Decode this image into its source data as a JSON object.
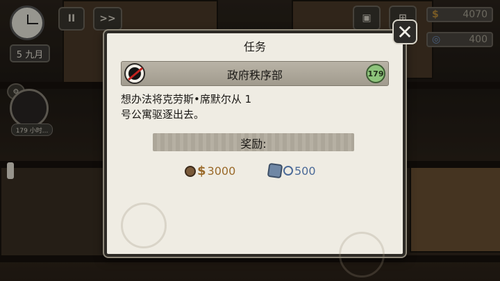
{
  "hud": {
    "date_label": "5 九月",
    "pause_label": "II",
    "fastforward_label": ">>",
    "money": {
      "symbol": "$",
      "value": "4070"
    },
    "reputation": {
      "symbol": "◎",
      "value": "400"
    }
  },
  "side_task": {
    "timer_label": "179 小时..."
  },
  "dialog": {
    "title": "任务",
    "close_label": "✕",
    "faction": {
      "name": "政府秩序部",
      "badge_value": "179"
    },
    "task_text": "想办法将克劳斯•席默尔从 1\n号公寓驱逐出去。",
    "reward_label": "奖励:",
    "rewards": {
      "money": {
        "symbol": "$",
        "value": "3000"
      },
      "reputation": {
        "value": "500"
      }
    }
  },
  "colors": {
    "money_gold": "#9a6a2a",
    "reputation_blue": "#4b6a98",
    "badge_green": "#8dc37b",
    "faction_red": "#c3231f"
  }
}
